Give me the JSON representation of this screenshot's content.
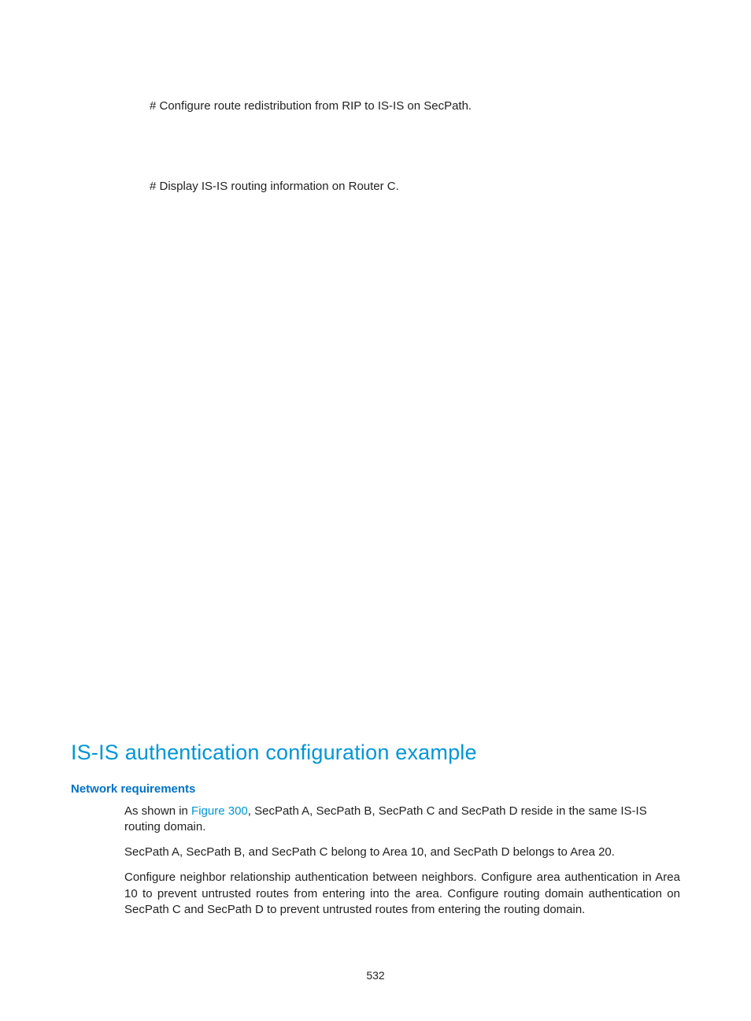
{
  "para1": "# Configure route redistribution from RIP to IS-IS on SecPath.",
  "para2": "# Display IS-IS routing information on Router C.",
  "h2": "IS-IS authentication configuration example",
  "h3": "Network requirements",
  "p_asshown_prefix": "As shown in ",
  "p_asshown_link": "Figure 300",
  "p_asshown_suffix": ", SecPath A, SecPath B, SecPath C and SecPath D reside in the same IS-IS routing domain.",
  "p_area": "SecPath A, SecPath B, and SecPath C belong to Area 10, and SecPath D belongs to Area 20.",
  "p_config": "Configure neighbor relationship authentication between neighbors. Configure area authentication in Area 10 to prevent untrusted routes from entering into the area. Configure routing domain authentication on SecPath C and SecPath D to prevent untrusted routes from entering the routing domain.",
  "page_number": "532"
}
